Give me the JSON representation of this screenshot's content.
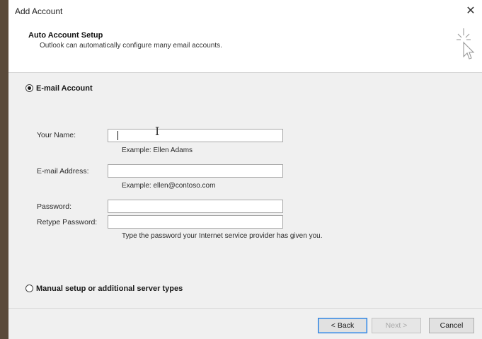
{
  "window": {
    "title": "Add Account"
  },
  "header": {
    "title": "Auto Account Setup",
    "subtitle": "Outlook can automatically configure many email accounts."
  },
  "email_option": {
    "label": "E-mail Account",
    "selected": true
  },
  "fields": {
    "name": {
      "label": "Your Name:",
      "value": "",
      "hint": "Example: Ellen Adams"
    },
    "email": {
      "label": "E-mail Address:",
      "value": "",
      "hint": "Example: ellen@contoso.com"
    },
    "password": {
      "label": "Password:",
      "value": ""
    },
    "retype_password": {
      "label": "Retype Password:",
      "value": ""
    },
    "password_hint": "Type the password your Internet service provider has given you."
  },
  "manual_option": {
    "label": "Manual setup or additional server types",
    "selected": false
  },
  "buttons": {
    "back": "< Back",
    "next": "Next >",
    "cancel": "Cancel"
  }
}
